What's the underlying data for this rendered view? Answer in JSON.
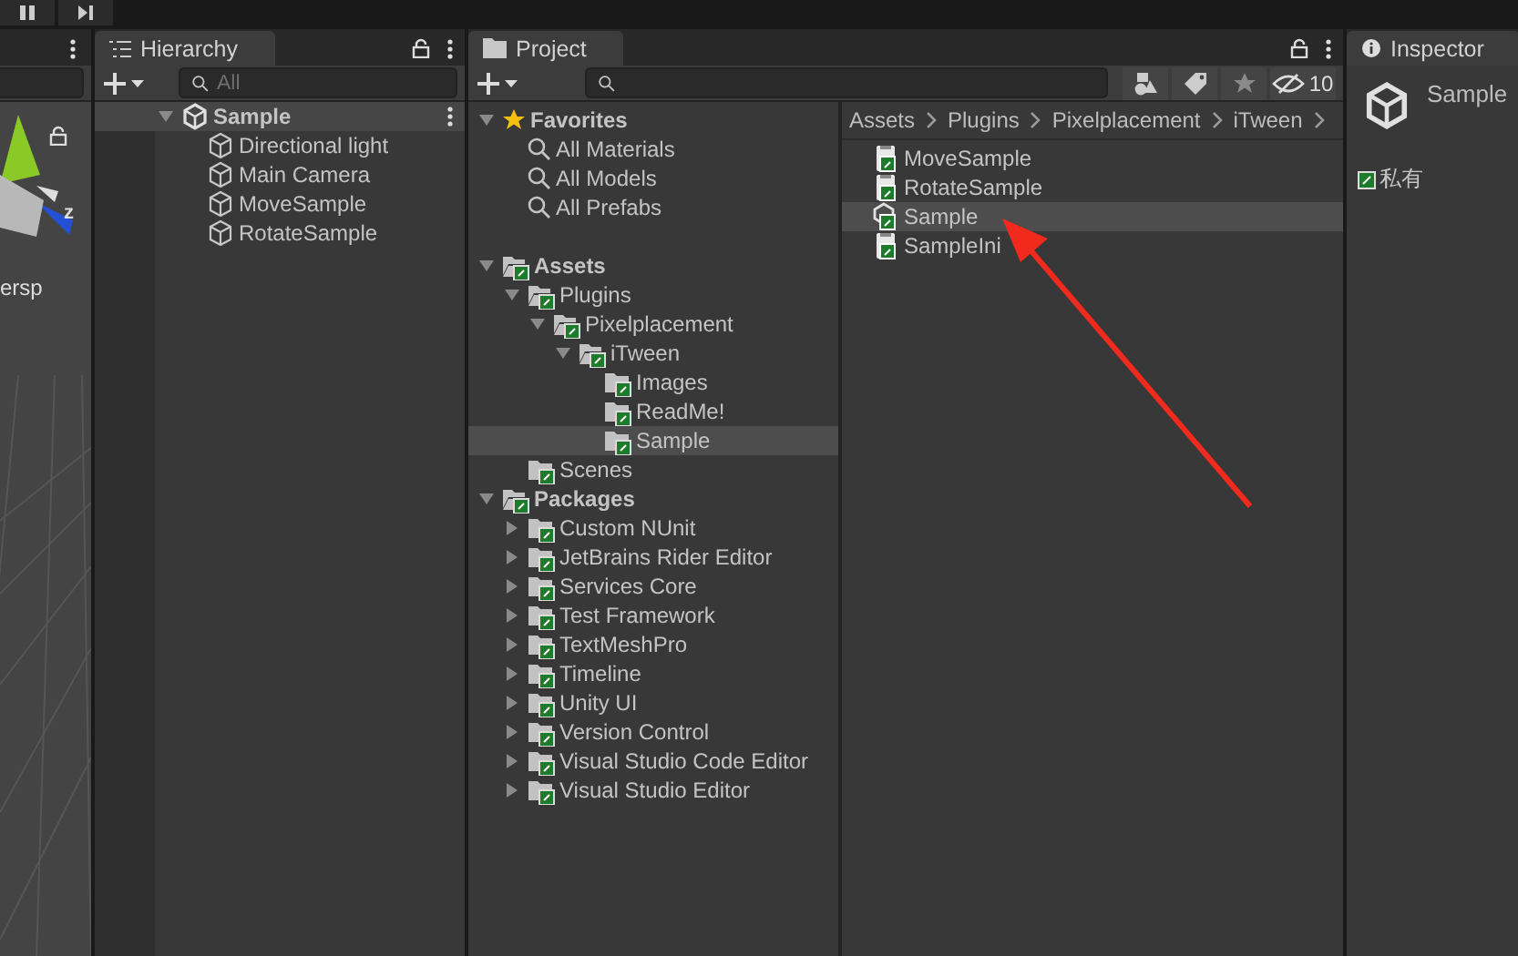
{
  "toolbar": {
    "buttons": [
      {
        "kind": "pause"
      },
      {
        "kind": "step"
      }
    ]
  },
  "scene": {
    "axis_label": "z",
    "view_label": "ersp"
  },
  "hierarchy": {
    "title": "Hierarchy",
    "search": {
      "placeholder": "All"
    },
    "scene": {
      "label": "Sample",
      "expanded": true,
      "children": [
        {
          "label": "Directional light"
        },
        {
          "label": "Main Camera"
        },
        {
          "label": "MoveSample"
        },
        {
          "label": "RotateSample"
        }
      ]
    }
  },
  "project": {
    "title": "Project",
    "hidden_count": "10",
    "favorites": {
      "label": "Favorites",
      "expanded": true,
      "items": [
        {
          "label": "All Materials"
        },
        {
          "label": "All Models"
        },
        {
          "label": "All Prefabs"
        }
      ]
    },
    "tree": [
      {
        "label": "Assets",
        "expanded": true,
        "selected": false,
        "children": [
          {
            "label": "Plugins",
            "expanded": true,
            "selected": false,
            "children": [
              {
                "label": "Pixelplacement",
                "expanded": true,
                "selected": false,
                "children": [
                  {
                    "label": "iTween",
                    "expanded": true,
                    "selected": false,
                    "children": [
                      {
                        "label": "Images",
                        "selected": false
                      },
                      {
                        "label": "ReadMe!",
                        "selected": false
                      },
                      {
                        "label": "Sample",
                        "selected": true
                      }
                    ]
                  }
                ]
              }
            ]
          },
          {
            "label": "Scenes",
            "selected": false
          }
        ]
      },
      {
        "label": "Packages",
        "expanded": true,
        "selected": false,
        "children": [
          {
            "label": "Custom NUnit",
            "expanded": false,
            "selected": false
          },
          {
            "label": "JetBrains Rider Editor",
            "expanded": false,
            "selected": false
          },
          {
            "label": "Services Core",
            "expanded": false,
            "selected": false
          },
          {
            "label": "Test Framework",
            "expanded": false,
            "selected": false
          },
          {
            "label": "TextMeshPro",
            "expanded": false,
            "selected": false
          },
          {
            "label": "Timeline",
            "expanded": false,
            "selected": false
          },
          {
            "label": "Unity UI",
            "expanded": false,
            "selected": false
          },
          {
            "label": "Version Control",
            "expanded": false,
            "selected": false
          },
          {
            "label": "Visual Studio Code Editor",
            "expanded": false,
            "selected": false
          },
          {
            "label": "Visual Studio Editor",
            "expanded": false,
            "selected": false
          }
        ]
      }
    ],
    "breadcrumb": [
      "Assets",
      "Plugins",
      "Pixelplacement",
      "iTween"
    ],
    "files": [
      {
        "label": "MoveSample",
        "kind": "script",
        "selected": false
      },
      {
        "label": "RotateSample",
        "kind": "script",
        "selected": false
      },
      {
        "label": "Sample",
        "kind": "scene",
        "selected": true
      },
      {
        "label": "SampleIni",
        "kind": "script",
        "selected": false
      }
    ]
  },
  "inspector": {
    "title": "Inspector",
    "asset_name": "Sample",
    "label": "私有"
  }
}
